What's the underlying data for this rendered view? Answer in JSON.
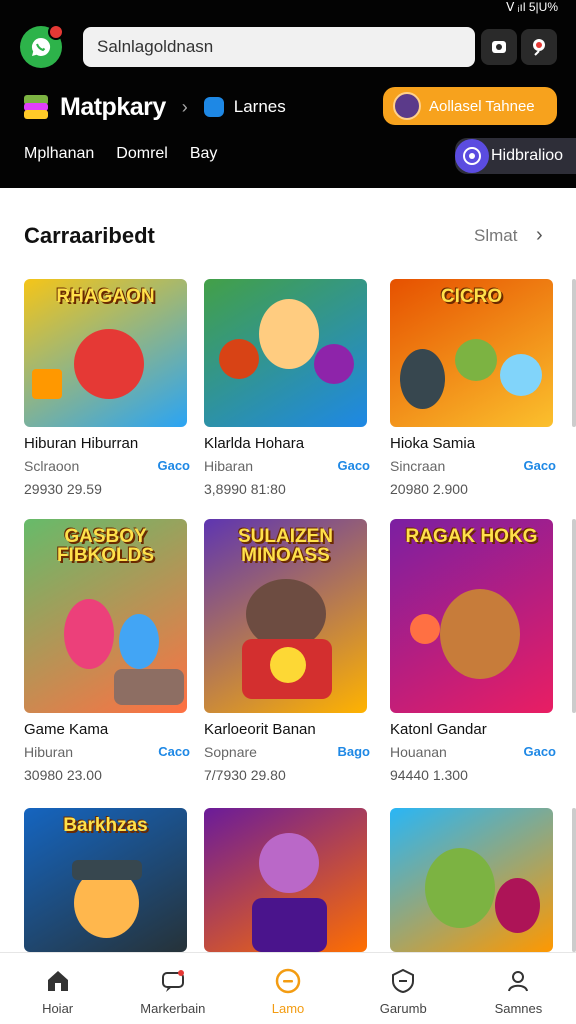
{
  "status": {
    "text": "ᐯ ᵢıl 5|U%"
  },
  "search": {
    "value": "Salnlagoldnasn"
  },
  "brand": {
    "title": "Matpkary",
    "crumb": "Larnes"
  },
  "promo": {
    "label": "Aollasel Tahnee"
  },
  "nav_tabs": [
    "Mplhanan",
    "Domrel",
    "Bay"
  ],
  "pill": {
    "label": "Hidbralioo"
  },
  "section": {
    "title": "Carraaribedt",
    "see_all": "Slmat"
  },
  "cards": [
    {
      "title": "RHAGAON",
      "name": "Hiburan Hiburran",
      "sub": "Sclraoon",
      "tag": "Gaco",
      "num": "29930 29.59",
      "colors": [
        "#f5c518",
        "#2aa4f4"
      ]
    },
    {
      "title": "",
      "name": "Klarlda Hohara",
      "sub": "Hibaran",
      "tag": "Gaco",
      "num": "3,8990 81:80",
      "colors": [
        "#43a047",
        "#1e88e5"
      ]
    },
    {
      "title": "CICRO",
      "name": "Hioka Samia",
      "sub": "Sincraan",
      "tag": "Gaco",
      "num": "20980 2.900",
      "colors": [
        "#e65100",
        "#fbc02d"
      ]
    },
    {
      "title": "GASBOY FIBKOLDS",
      "name": "Game Kama",
      "sub": "Hiburan",
      "tag": "Caco",
      "num": "30980 23.00",
      "colors": [
        "#66bb6a",
        "#ff7043"
      ]
    },
    {
      "title": "SULAIZEN MINOASS",
      "name": "Karloeorit Banan",
      "sub": "Sopnare",
      "tag": "Bago",
      "num": "7/7930 29.80",
      "colors": [
        "#5e35b1",
        "#ffb300"
      ]
    },
    {
      "title": "RAGAK HOKG",
      "name": "Katonl Gandar",
      "sub": "Houanan",
      "tag": "Gaco",
      "num": "94440 1.300",
      "colors": [
        "#7b1fa2",
        "#e91e63"
      ]
    },
    {
      "title": "Barkhzas",
      "name": "",
      "sub": "",
      "tag": "",
      "num": "",
      "colors": [
        "#1565c0",
        "#263238"
      ]
    },
    {
      "title": "",
      "name": "",
      "sub": "",
      "tag": "",
      "num": "",
      "colors": [
        "#6a1b9a",
        "#ff6f00"
      ]
    },
    {
      "title": "",
      "name": "",
      "sub": "",
      "tag": "",
      "num": "",
      "colors": [
        "#29b6f6",
        "#ff9800"
      ]
    }
  ],
  "bottom_nav": [
    {
      "label": "Hoiar",
      "icon": "home-icon"
    },
    {
      "label": "Markerbain",
      "icon": "chat-icon"
    },
    {
      "label": "Lamo",
      "icon": "games-icon"
    },
    {
      "label": "Garumb",
      "icon": "shield-icon"
    },
    {
      "label": "Samnes",
      "icon": "profile-icon"
    }
  ],
  "accent": "#f7a21d"
}
